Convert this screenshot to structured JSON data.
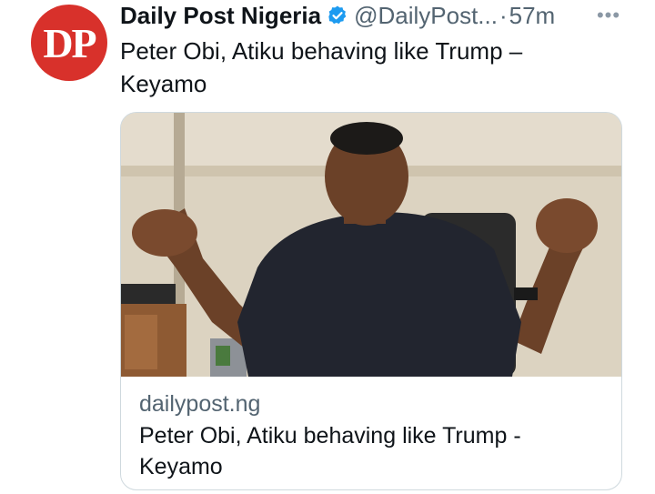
{
  "author": {
    "avatar_text": "DP",
    "name": "Daily Post Nigeria",
    "handle": "@DailyPost...",
    "separator": "·",
    "time": "57m"
  },
  "icons": {
    "verified": "verified-badge-icon",
    "more": "more-options-icon"
  },
  "more_glyph": "•••",
  "tweet": {
    "text": "Peter Obi, Atiku behaving like Trump – Keyamo"
  },
  "card": {
    "domain": "dailypost.ng",
    "title": "Peter Obi, Atiku behaving like Trump - Keyamo"
  },
  "colors": {
    "avatar_bg": "#d8312b",
    "verified_blue": "#1d9bf0",
    "secondary_text": "#536471"
  }
}
